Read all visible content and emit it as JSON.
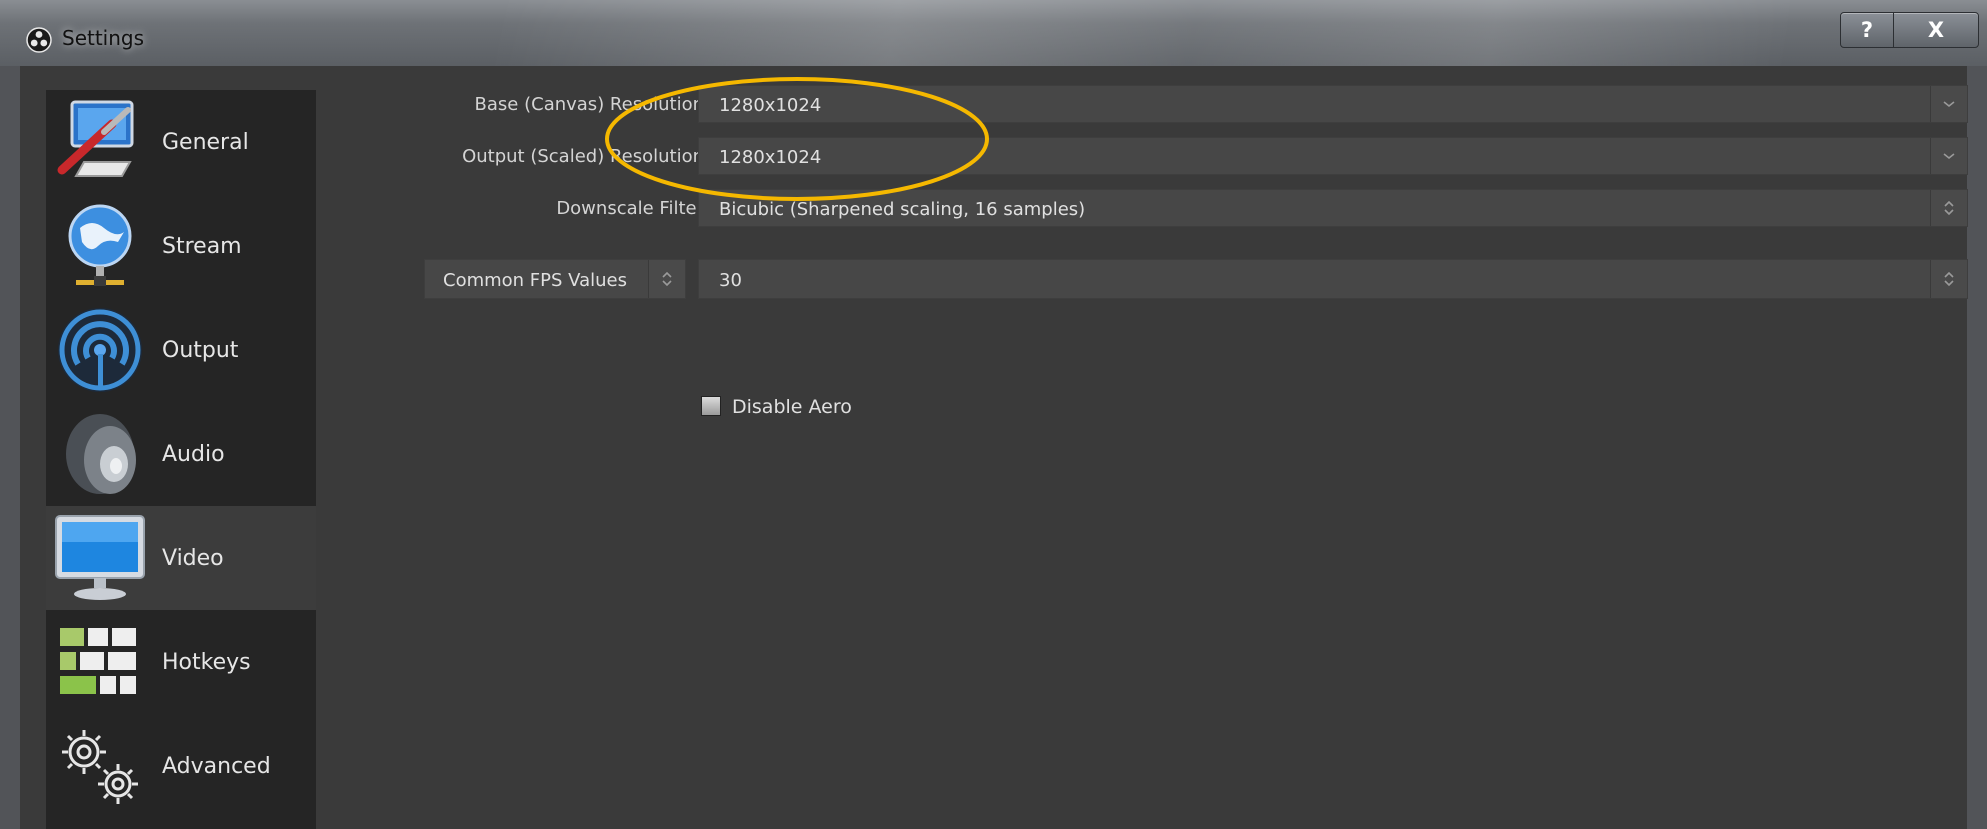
{
  "window": {
    "title": "Settings",
    "help_button": "?",
    "close_button": "X"
  },
  "sidebar": {
    "items": [
      {
        "label": "General",
        "icon": "general-settings-icon"
      },
      {
        "label": "Stream",
        "icon": "globe-network-icon"
      },
      {
        "label": "Output",
        "icon": "broadcast-signal-icon"
      },
      {
        "label": "Audio",
        "icon": "speaker-icon"
      },
      {
        "label": "Video",
        "icon": "monitor-icon"
      },
      {
        "label": "Hotkeys",
        "icon": "keyboard-icon"
      },
      {
        "label": "Advanced",
        "icon": "gears-icon"
      }
    ],
    "active": "Video"
  },
  "video": {
    "base_resolution": {
      "label": "Base (Canvas) Resolution",
      "value": "1280x1024"
    },
    "output_resolution": {
      "label": "Output (Scaled) Resolution",
      "value": "1280x1024"
    },
    "downscale_filter": {
      "label": "Downscale Filter",
      "value": "Bicubic (Sharpened scaling, 16 samples)"
    },
    "fps": {
      "type_label": "Common FPS Values",
      "value": "30"
    },
    "disable_aero": {
      "label": "Disable Aero",
      "checked": false
    }
  },
  "colors": {
    "highlight": "#f5b800",
    "background": "#3a3a3a",
    "sidebar": "#252525"
  }
}
